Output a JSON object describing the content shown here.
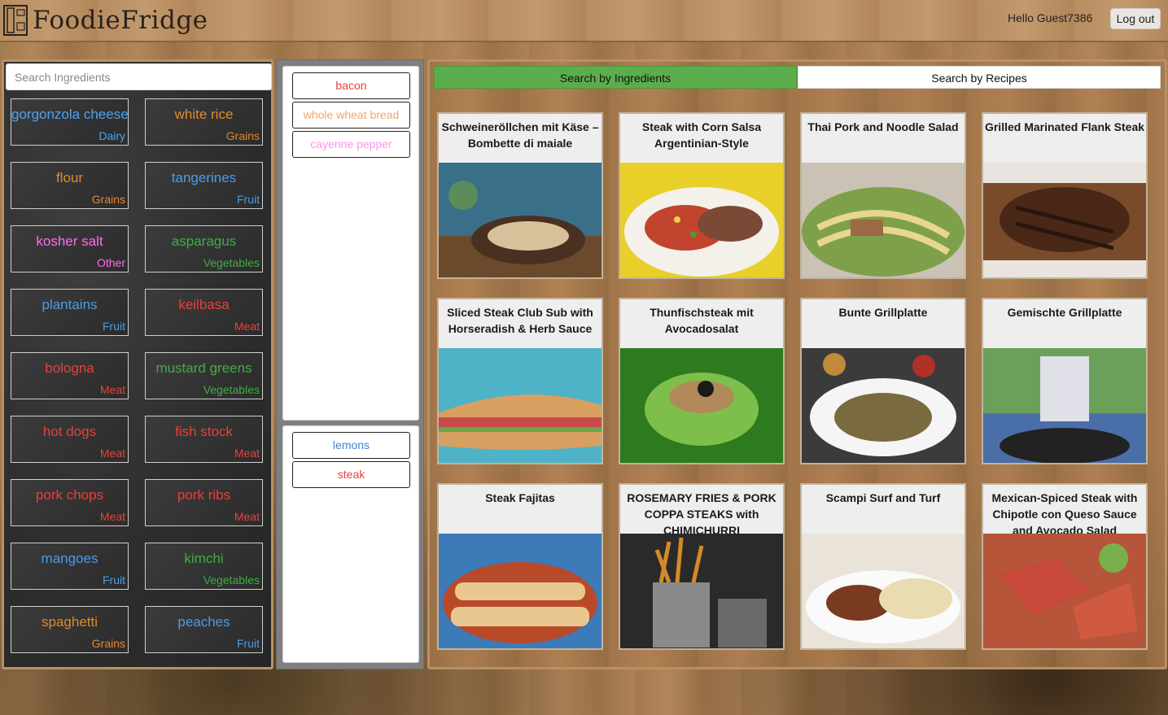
{
  "header": {
    "app_name": "FoodieFridge",
    "greeting": "Hello Guest7386",
    "logout_label": "Log out"
  },
  "sidebar": {
    "search_placeholder": "Search Ingredients",
    "ingredients": [
      {
        "name": "gorgonzola cheese",
        "category": "Dairy",
        "color": "#4da3f0"
      },
      {
        "name": "white rice",
        "category": "Grains",
        "color": "#e08a2e"
      },
      {
        "name": "flour",
        "category": "Grains",
        "color": "#e08a2e"
      },
      {
        "name": "tangerines",
        "category": "Fruit",
        "color": "#4d9be6"
      },
      {
        "name": "kosher salt",
        "category": "Other",
        "color": "#ff6ee8"
      },
      {
        "name": "asparagus",
        "category": "Vegetables",
        "color": "#3fae45"
      },
      {
        "name": "plantains",
        "category": "Fruit",
        "color": "#4d9be6"
      },
      {
        "name": "keilbasa",
        "category": "Meat",
        "color": "#e8403a"
      },
      {
        "name": "bologna",
        "category": "Meat",
        "color": "#e8403a"
      },
      {
        "name": "mustard greens",
        "category": "Vegetables",
        "color": "#3fae45"
      },
      {
        "name": "hot dogs",
        "category": "Meat",
        "color": "#e8403a"
      },
      {
        "name": "fish stock",
        "category": "Meat",
        "color": "#e8403a"
      },
      {
        "name": "pork chops",
        "category": "Meat",
        "color": "#e8403a"
      },
      {
        "name": "pork ribs",
        "category": "Meat",
        "color": "#e8403a"
      },
      {
        "name": "mangoes",
        "category": "Fruit",
        "color": "#4d9be6"
      },
      {
        "name": "kimchi",
        "category": "Vegetables",
        "color": "#3fae45"
      },
      {
        "name": "spaghetti",
        "category": "Grains",
        "color": "#e08a2e"
      },
      {
        "name": "peaches",
        "category": "Fruit",
        "color": "#4d9be6"
      }
    ]
  },
  "selected": {
    "top": [
      {
        "name": "bacon",
        "color": "#e8403a"
      },
      {
        "name": "whole wheat bread",
        "color": "#f0a66a"
      },
      {
        "name": "cayenne pepper",
        "color": "#ff8ef0"
      }
    ],
    "bottom": [
      {
        "name": "lemons",
        "color": "#3b86cf"
      },
      {
        "name": "steak",
        "color": "#e8403a"
      }
    ]
  },
  "tabs": {
    "by_ingredients": "Search by Ingredients",
    "by_recipes": "Search by Recipes"
  },
  "recipes": [
    {
      "title": "Schweineröllchen mit Käse – Bombette di maiale",
      "image": "wrap-sandwich"
    },
    {
      "title": "Steak with Corn Salsa Argentinian-Style",
      "image": "steak-corn-salsa"
    },
    {
      "title": "Thai Pork and Noodle Salad",
      "image": "noodle-salad"
    },
    {
      "title": "Grilled Marinated Flank Steak",
      "image": "grilled-steak"
    },
    {
      "title": "Sliced Steak Club Sub with Horseradish & Herb Sauce",
      "image": "steak-sub"
    },
    {
      "title": "Thunfischsteak mit Avocadosalat",
      "image": "tuna-avocado"
    },
    {
      "title": "Bunte Grillplatte",
      "image": "grill-platter"
    },
    {
      "title": "Gemischte Grillplatte",
      "image": "grilling"
    },
    {
      "title": "Steak Fajitas",
      "image": "fajitas"
    },
    {
      "title": "ROSEMARY FRIES & PORK COPPA STEAKS with CHIMICHURRI",
      "image": "fries"
    },
    {
      "title": "Scampi Surf and Turf",
      "image": "surf-turf"
    },
    {
      "title": "Mexican-Spiced Steak with Chipotle con Queso Sauce and Avocado Salad",
      "image": "spiced-steak"
    }
  ]
}
